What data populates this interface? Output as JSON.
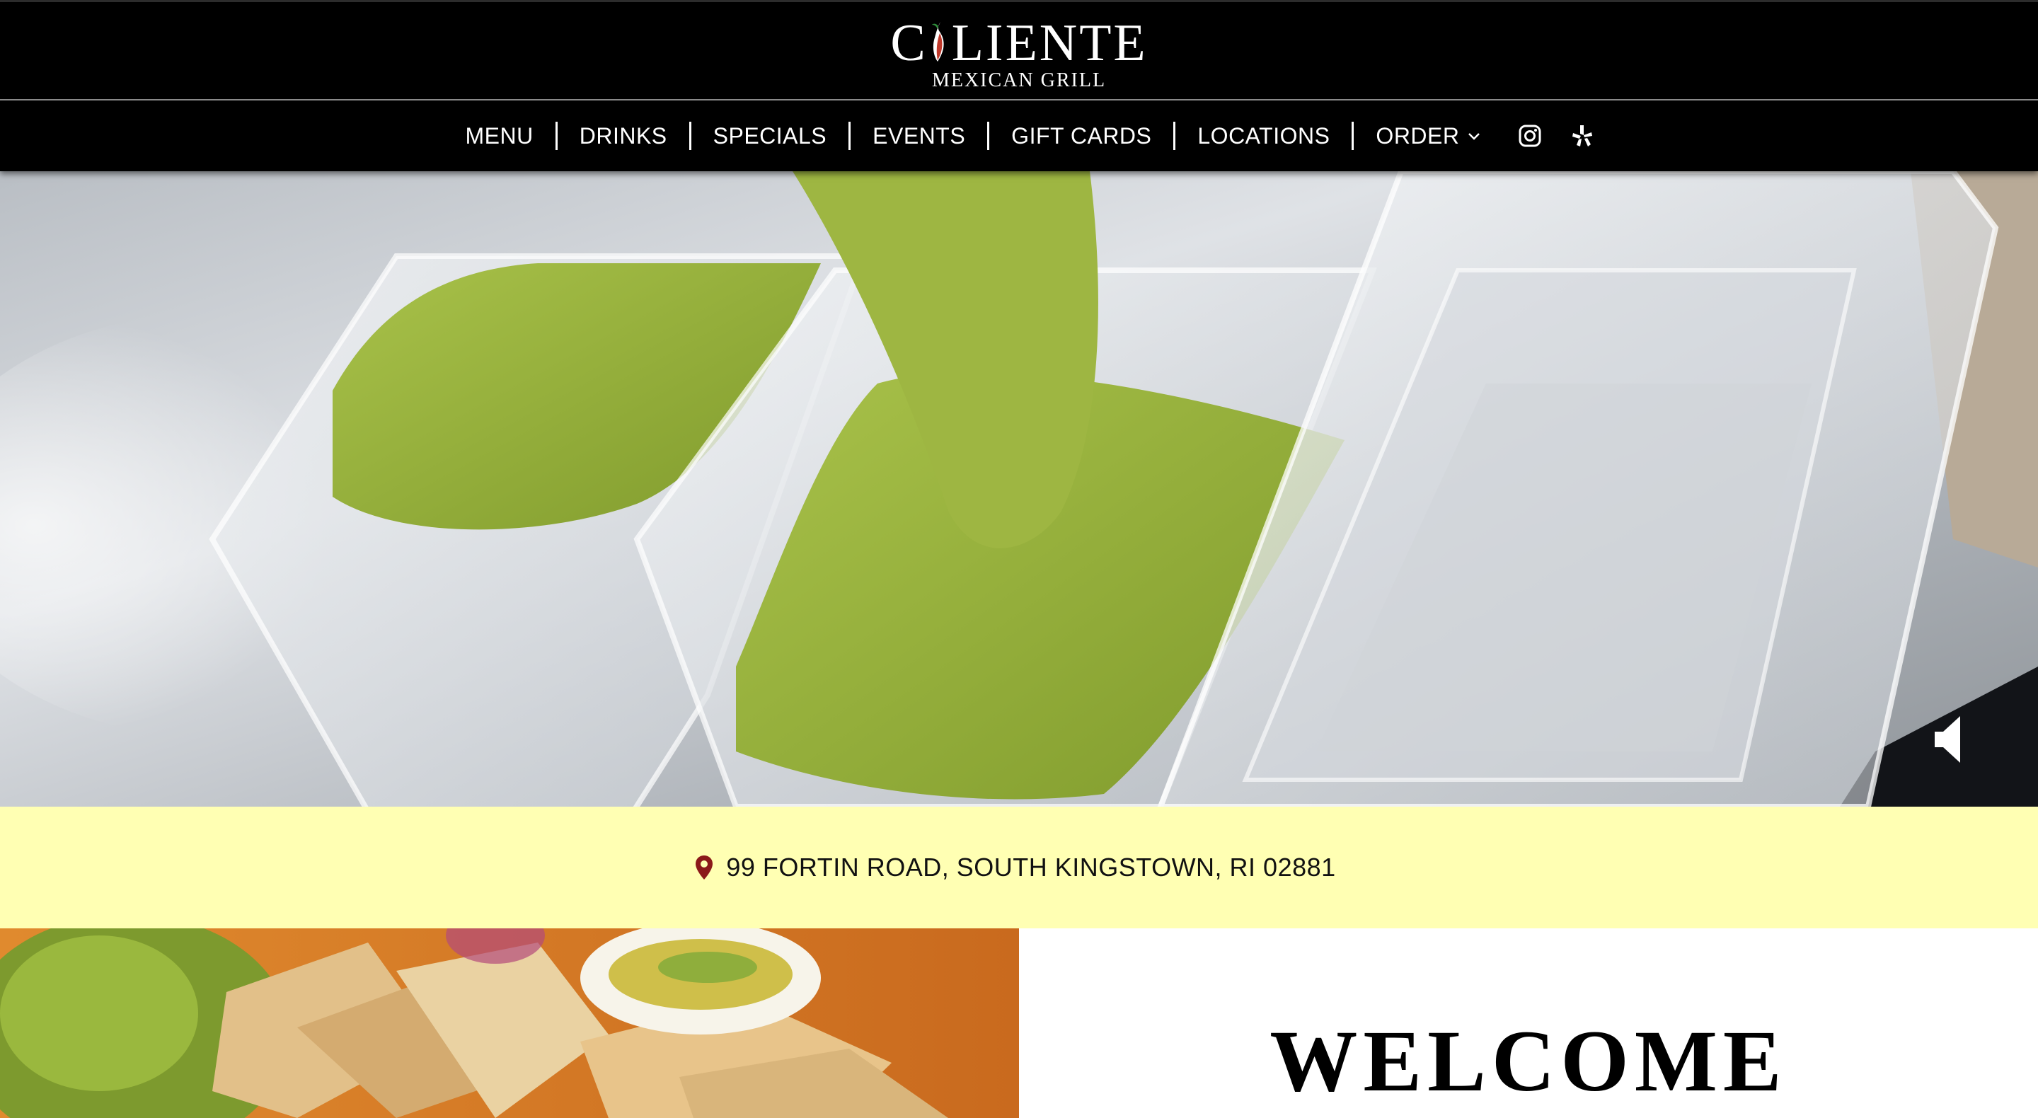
{
  "brand": {
    "name": "CALIENTE",
    "name_left": "C",
    "name_right": "LIENTE",
    "tagline": "MEXICAN GRILL"
  },
  "nav": {
    "items": [
      {
        "label": "MENU"
      },
      {
        "label": "DRINKS"
      },
      {
        "label": "SPECIALS"
      },
      {
        "label": "EVENTS"
      },
      {
        "label": "GIFT CARDS"
      },
      {
        "label": "LOCATIONS"
      },
      {
        "label": "ORDER"
      }
    ],
    "social_icons": [
      "instagram-icon",
      "yelp-icon"
    ]
  },
  "hero": {
    "media": "video",
    "sound_icon": "speaker-muted-icon"
  },
  "address": {
    "icon": "map-pin-icon",
    "text": "99 FORTIN ROAD, SOUTH KINGSTOWN, RI 02881"
  },
  "welcome": {
    "heading": "WELCOME"
  },
  "colors": {
    "header_bg": "#000000",
    "address_bg": "#ffffb3",
    "pin": "#8b1a1a",
    "salsa": "#97b23c"
  }
}
